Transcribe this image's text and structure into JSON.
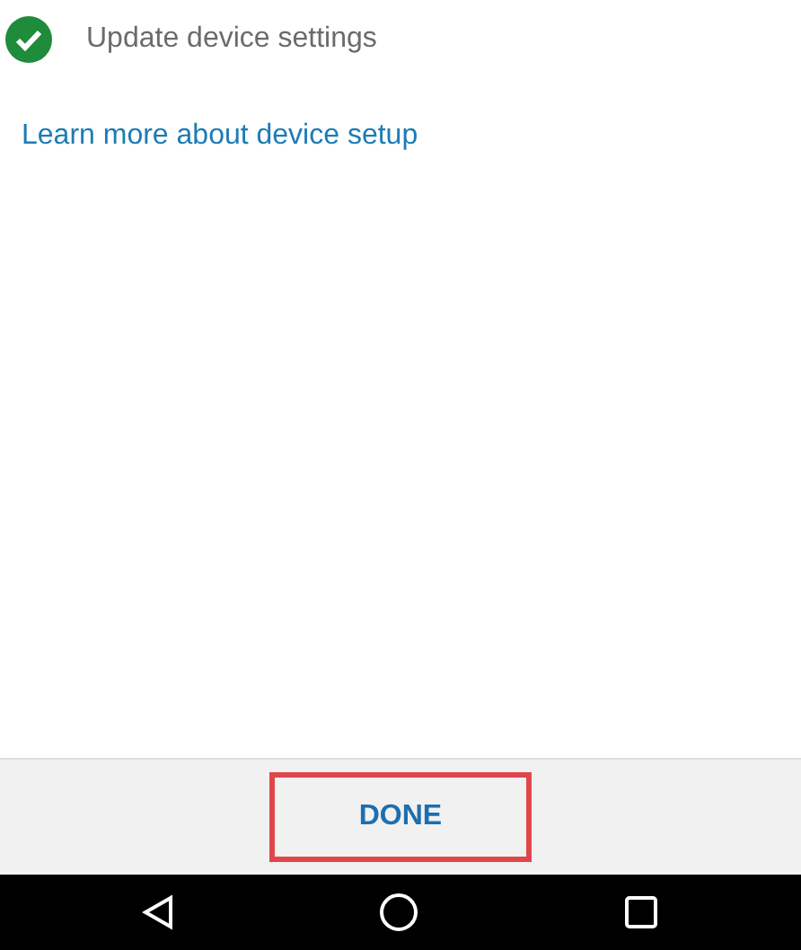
{
  "steps": [
    {
      "label": "Update device settings",
      "done": true
    }
  ],
  "link": "Learn more about device setup",
  "footer": {
    "button": "DONE",
    "highlighted": true
  }
}
